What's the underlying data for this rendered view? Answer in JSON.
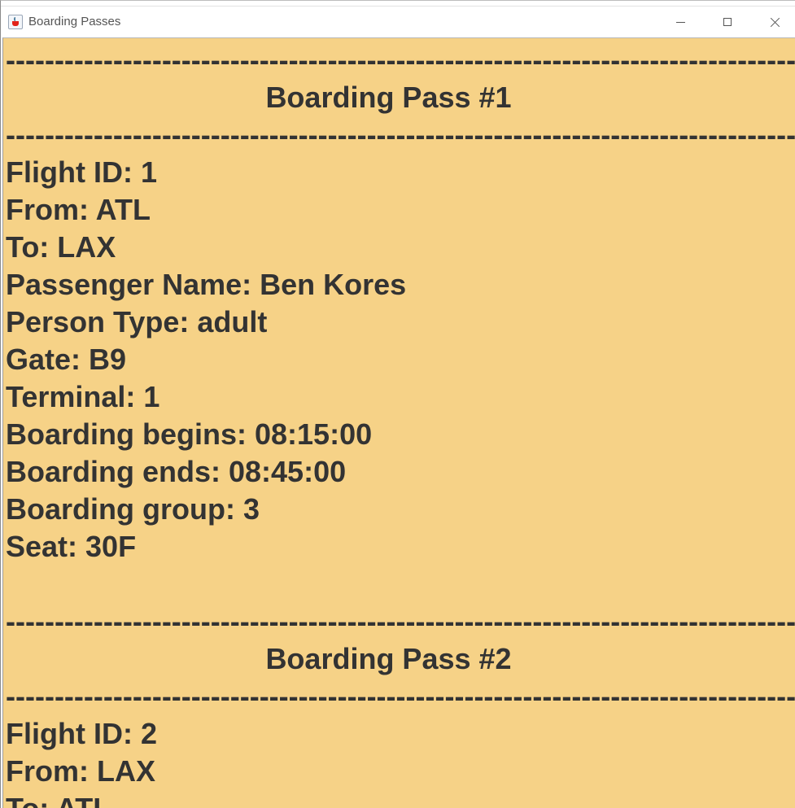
{
  "window": {
    "title": "Boarding Passes"
  },
  "divider": "--------------------------------------------------------------------------------------------------",
  "passes": [
    {
      "heading": "Boarding Pass #1",
      "flight_id": "Flight ID: 1",
      "from": "From: ATL",
      "to": "To: LAX",
      "passenger_name": "Passenger Name: Ben Kores",
      "person_type": "Person Type: adult",
      "gate": "Gate: B9",
      "terminal": "Terminal: 1",
      "boarding_begins": "Boarding begins: 08:15:00",
      "boarding_ends": "Boarding ends: 08:45:00",
      "boarding_group": "Boarding group: 3",
      "seat": "Seat: 30F"
    },
    {
      "heading": "Boarding Pass #2",
      "flight_id": "Flight ID: 2",
      "from": "From: LAX",
      "to": "To: ATL"
    }
  ],
  "icons": {
    "app": "java-app-icon",
    "minimize": "minimize-icon",
    "maximize": "maximize-icon",
    "close": "close-icon"
  }
}
